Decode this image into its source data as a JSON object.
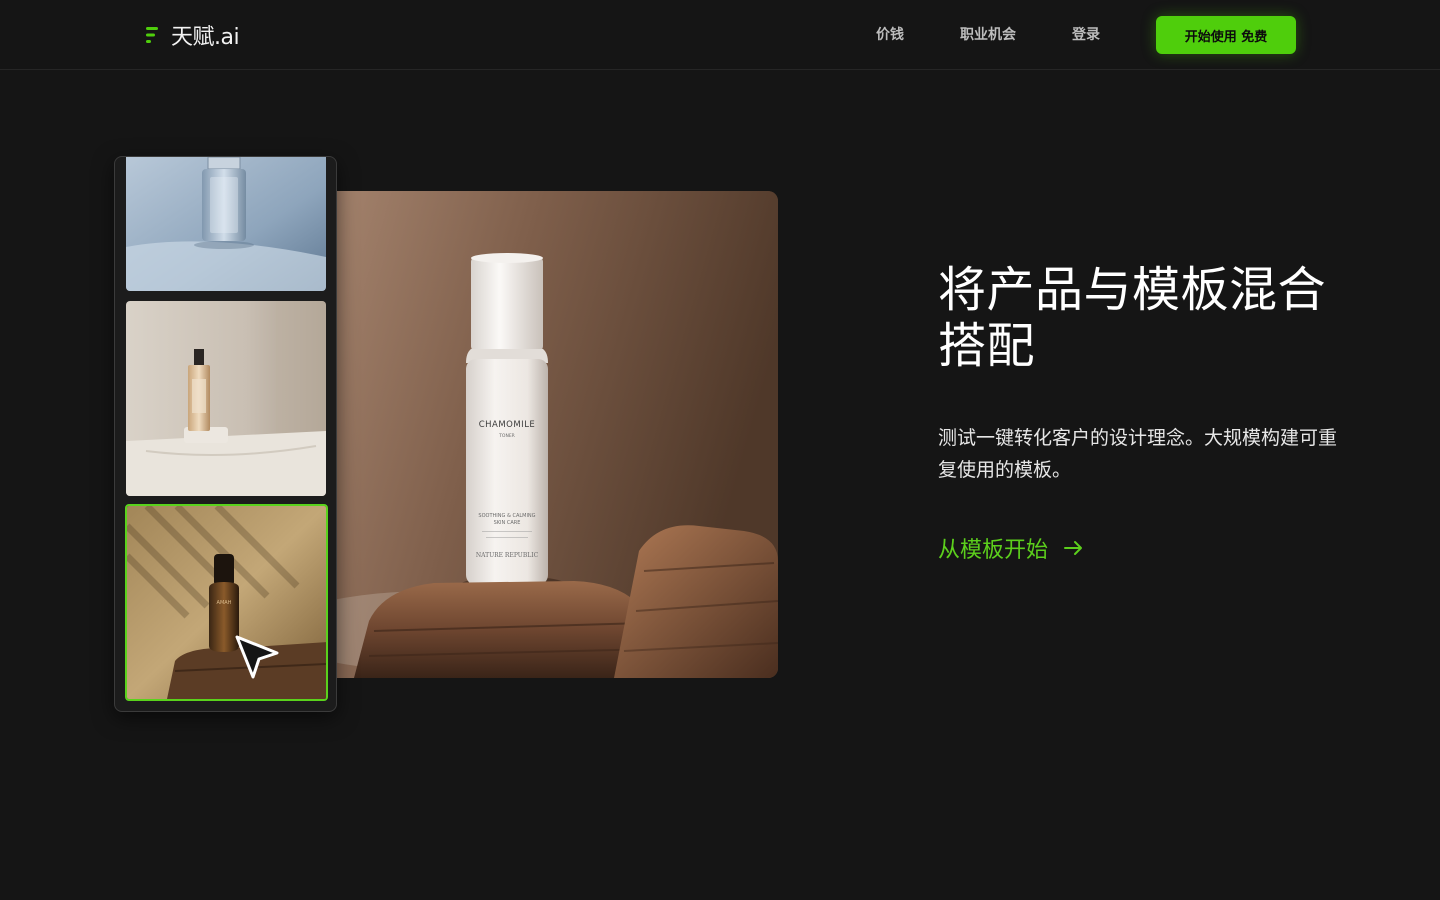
{
  "header": {
    "logo_text": "天赋.ai",
    "logo_icon": "stacked-bars-logo-icon",
    "nav": {
      "pricing": "价钱",
      "careers": "职业机会",
      "login": "登录"
    },
    "cta_label": "开始使用 免费"
  },
  "showcase": {
    "main_image": {
      "product_name": "CHAMOMILE",
      "product_type": "TONER",
      "tagline_1": "SOOTHING & CALMING",
      "tagline_2": "SKIN CARE",
      "brand": "NATURE REPUBLIC"
    },
    "thumbnails": [
      {
        "subject": "clear glass perfume bottle on blue backdrop",
        "selected": false
      },
      {
        "subject": "amber perfume bottle on marble pedestal",
        "selected": false
      },
      {
        "subject": "dark amber serum bottle on rock",
        "selected": true
      }
    ],
    "thumb3_label": "AMAH"
  },
  "hero": {
    "headline": "将产品与模板混合搭配",
    "description": "测试一键转化客户的设计理念。大规模构建可重复使用的模板。",
    "link_label": "从模板开始",
    "link_icon": "arrow-right-icon"
  },
  "colors": {
    "background": "#151515",
    "accent": "#4fce0c",
    "accent_text": "#5ccf1c",
    "nav_text": "#bdbdbd"
  }
}
